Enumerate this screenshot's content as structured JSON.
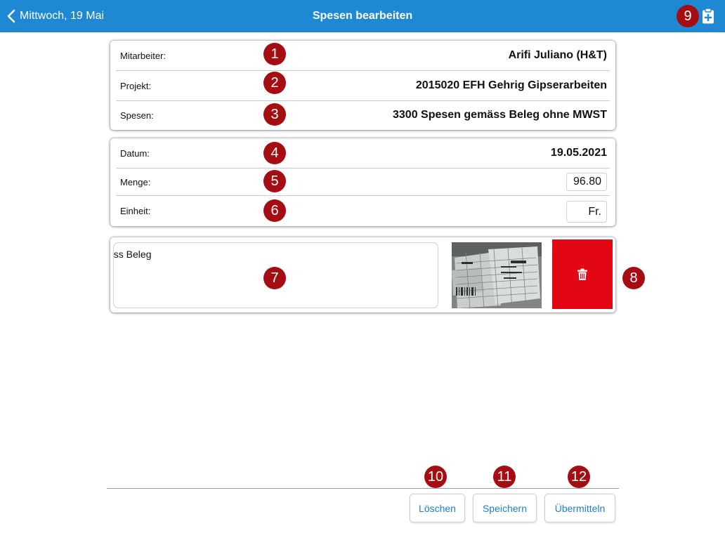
{
  "navbar": {
    "back_label": "Mittwoch, 19 Mai",
    "title": "Spesen bearbeiten",
    "bg_color": "#1e88d2"
  },
  "header_card": {
    "rows": [
      {
        "label": "Mitarbeiter:",
        "value": "Arifi Juliano (H&T)"
      },
      {
        "label": "Projekt:",
        "value": "2015020 EFH Gehrig Gipserarbeiten"
      },
      {
        "label": "Spesen:",
        "value": "3300 Spesen gemäss Beleg ohne MWST"
      }
    ]
  },
  "detail_card": {
    "datum_label": "Datum:",
    "datum_value": "19.05.2021",
    "menge_label": "Menge:",
    "menge_value": "96.80",
    "einheit_label": "Einheit:",
    "einheit_value": "Fr."
  },
  "note_card": {
    "note_text": "äss Beleg",
    "photo_icon": "receipt-photo",
    "delete_icon": "trash-icon",
    "delete_color": "#e30613"
  },
  "badges": [
    "1",
    "2",
    "3",
    "4",
    "5",
    "6",
    "7",
    "8",
    "9",
    "10",
    "11",
    "12"
  ],
  "footer": {
    "delete_label": "Löschen",
    "save_label": "Speichern",
    "submit_label": "Übermitteln",
    "accent_color": "#1a7fd0"
  }
}
